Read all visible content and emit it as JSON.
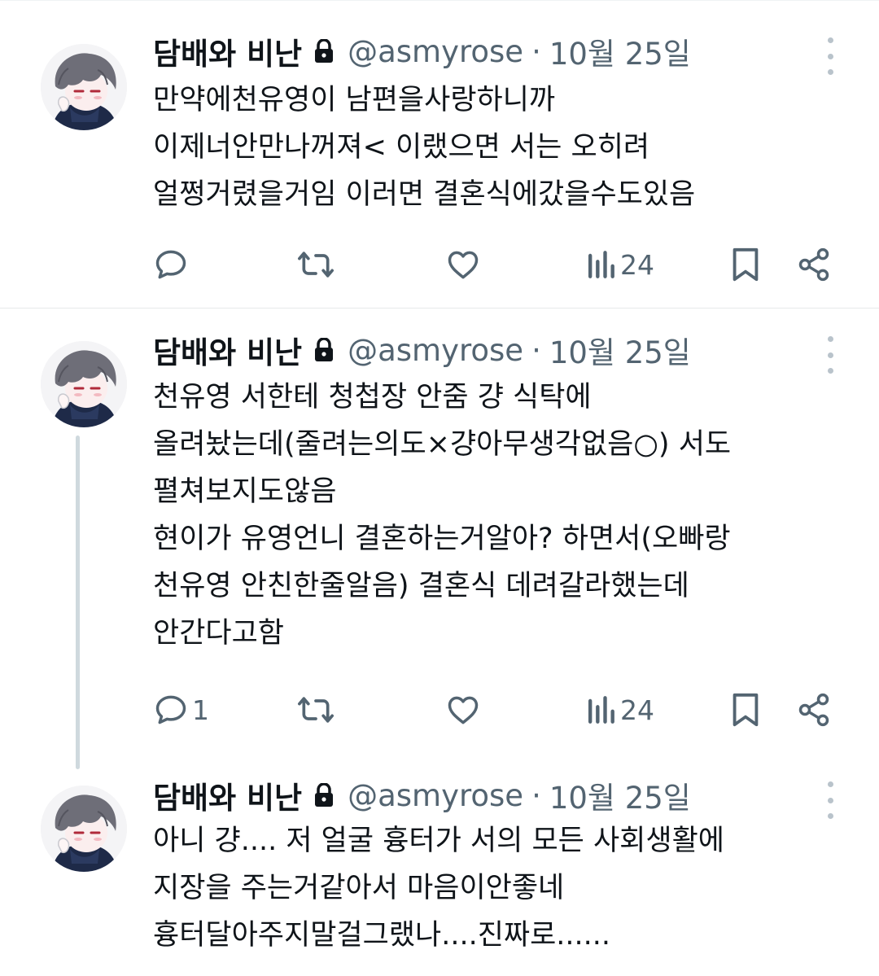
{
  "tweets": [
    {
      "author": {
        "name": "담배와 비난",
        "handle": "@asmyrose",
        "separator": "·",
        "date": "10월 25일"
      },
      "lines": [
        "만약에천유영이 남편을사랑하니까",
        "이제너안만나꺼져< 이랬으면 서는 오히려",
        "얼쩡거렸을거임 이러면 결혼식에갔을수도있음"
      ],
      "stats": {
        "replies": "",
        "reposts": "",
        "likes": "",
        "views": "24"
      }
    },
    {
      "author": {
        "name": "담배와 비난",
        "handle": "@asmyrose",
        "separator": "·",
        "date": "10월 25일"
      },
      "lines": [
        "천유영 서한테 청첩장 안줌 걍 식탁에",
        "올려놨는데(줄려는의도×걍아무생각없음○) 서도",
        "펼쳐보지도않음",
        "현이가 유영언니 결혼하는거알아? 하면서(오빠랑",
        "천유영 안친한줄알음) 결혼식 데려갈라했는데",
        "안간다고함"
      ],
      "stats": {
        "replies": "1",
        "reposts": "",
        "likes": "",
        "views": "24"
      }
    },
    {
      "author": {
        "name": "담배와 비난",
        "handle": "@asmyrose",
        "separator": "·",
        "date": "10월 25일"
      },
      "lines": [
        "아니 걍.... 저 얼굴 흉터가 서의 모든 사회생활에",
        "지장을 주는거같아서 마음이안좋네",
        "흉터달아주지말걸그랬나....진짜로......"
      ]
    }
  ],
  "icons": {
    "lock": "lock-icon",
    "more": "more-options-icon",
    "reply": "reply-icon",
    "repost": "repost-icon",
    "like": "like-icon",
    "views": "views-icon",
    "bookmark": "bookmark-icon",
    "share": "share-icon"
  },
  "colors": {
    "text": "#0f1419",
    "secondary": "#536471",
    "icon": "#536471",
    "thread_line": "#cfd9de",
    "divider": "#e7e9ea"
  }
}
